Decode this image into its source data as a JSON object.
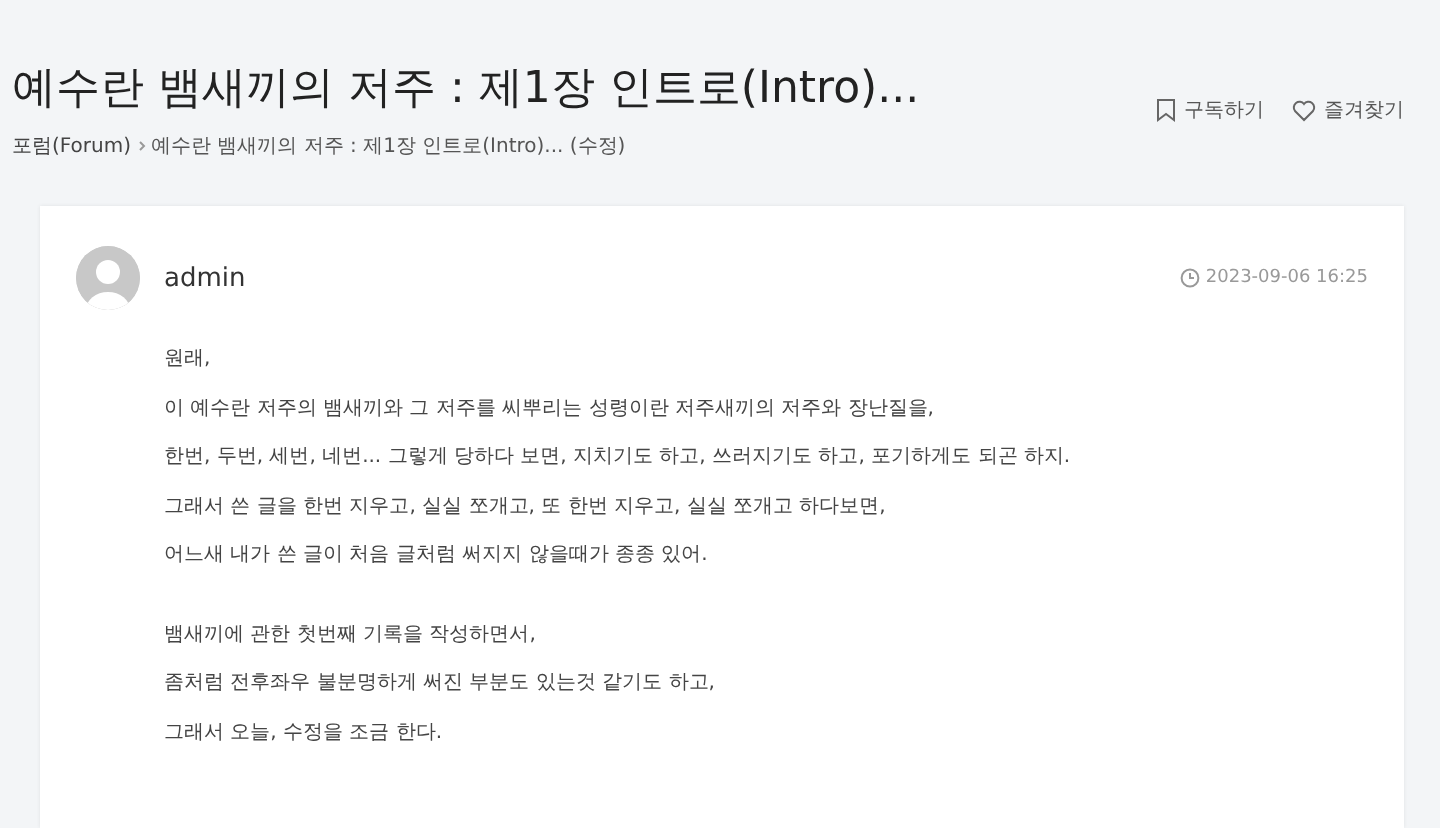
{
  "page_title": "예수란 뱀새끼의 저주 : 제1장 인트로(Intro)...",
  "breadcrumb": [
    {
      "label": "포럼(Forum)",
      "kind": "link"
    },
    {
      "label": "예수란 뱀새끼의 저주 : 제1장 인트로(Intro)... (수정)",
      "kind": "text"
    }
  ],
  "actions": [
    {
      "label": "구독하기",
      "kind": "bookmark"
    },
    {
      "label": "즐겨찾기",
      "kind": "heart"
    }
  ],
  "post": {
    "author": "admin",
    "date": "2023-09-06 16:25",
    "paragraph_groups": [
      [
        "원래,",
        "이 예수란 저주의 뱀새끼와 그 저주를 씨뿌리는 성령이란 저주새끼의 저주와 장난질을,",
        "한번, 두번, 세번, 네번... 그렇게 당하다 보면, 지치기도 하고, 쓰러지기도 하고, 포기하게도 되곤 하지.",
        "그래서 쓴 글을 한번 지우고, 실실 쪼개고, 또 한번 지우고, 실실 쪼개고 하다보면,",
        "어느새 내가 쓴 글이 처음 글처럼 써지지 않을때가 종종 있어."
      ],
      [
        "뱀새끼에 관한 첫번째 기록을 작성하면서,",
        "좀처럼 전후좌우 불분명하게 써진 부분도 있는것 같기도 하고,",
        "그래서 오늘, 수정을 조금 한다."
      ]
    ]
  }
}
